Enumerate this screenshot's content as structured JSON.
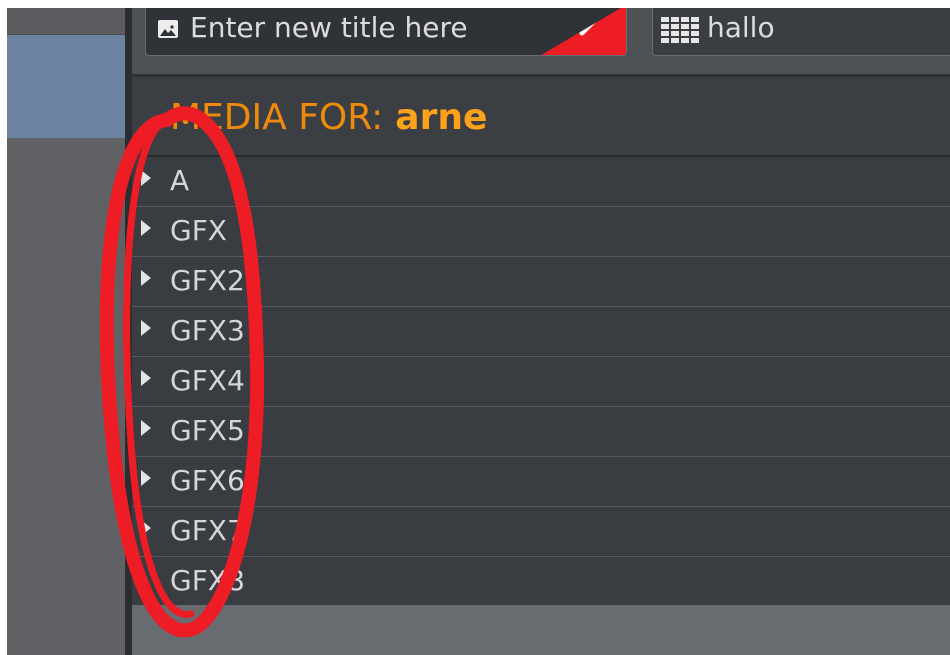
{
  "toolbar": {
    "title_placeholder": "Enter new title here",
    "title_icon": "image-icon",
    "edit_icon": "pencil-icon",
    "template_name": "hallo",
    "template_icon": "grid-icon"
  },
  "media": {
    "heading_prefix": "MEDIA FOR:",
    "user": "arne",
    "items": [
      {
        "label": "A"
      },
      {
        "label": "GFX"
      },
      {
        "label": "GFX2"
      },
      {
        "label": "GFX3"
      },
      {
        "label": "GFX4"
      },
      {
        "label": "GFX5"
      },
      {
        "label": "GFX6"
      },
      {
        "label": "GFX7"
      },
      {
        "label": "GFX8"
      }
    ]
  },
  "colors": {
    "accent_orange": "#f08a0c",
    "annotation_red": "#ee1c24",
    "panel_dark": "#393c40",
    "selection_blue": "#6b82a0"
  }
}
